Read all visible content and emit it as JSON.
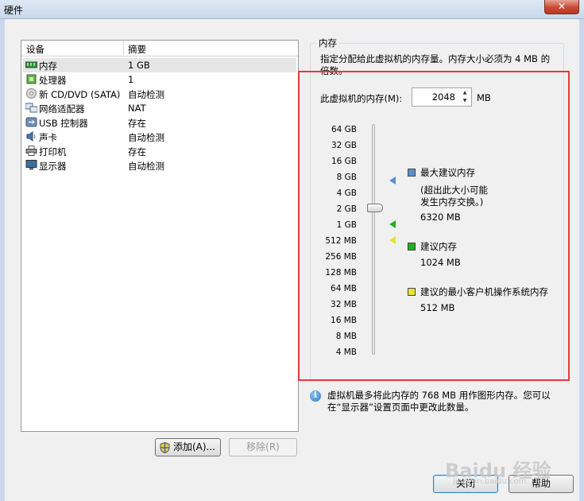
{
  "window": {
    "title": "硬件",
    "close_symbol": "✕"
  },
  "device_list": {
    "headers": {
      "device": "设备",
      "summary": "摘要"
    },
    "rows": [
      {
        "name": "内存",
        "summary": "1 GB",
        "icon": "memory-icon"
      },
      {
        "name": "处理器",
        "summary": "1",
        "icon": "processor-icon"
      },
      {
        "name": "新 CD/DVD (SATA)",
        "summary": "自动检测",
        "icon": "cd-dvd-icon"
      },
      {
        "name": "网络适配器",
        "summary": "NAT",
        "icon": "network-adapter-icon"
      },
      {
        "name": "USB 控制器",
        "summary": "存在",
        "icon": "usb-icon"
      },
      {
        "name": "声卡",
        "summary": "自动检测",
        "icon": "sound-card-icon"
      },
      {
        "name": "打印机",
        "summary": "存在",
        "icon": "printer-icon"
      },
      {
        "name": "显示器",
        "summary": "自动检测",
        "icon": "display-icon"
      }
    ],
    "add_button": "添加(A)...",
    "remove_button": "移除(R)"
  },
  "memory": {
    "group_title": "内存",
    "description": "指定分配给此虚拟机的内存量。内存大小必须为 4 MB 的倍数。",
    "memory_label": "此虚拟机的内存(M):",
    "memory_value": "2048",
    "unit": "MB",
    "slider_ticks": [
      "64 GB",
      "32 GB",
      "16 GB",
      "8 GB",
      "4 GB",
      "2 GB",
      "1 GB",
      "512 MB",
      "256 MB",
      "128 MB",
      "64 MB",
      "32 MB",
      "16 MB",
      "8 MB",
      "4 MB"
    ],
    "slider_value": "2 GB",
    "legend": {
      "max_title": "最大建议内存",
      "max_note_line1": "(超出此大小可能",
      "max_note_line2": "发生内存交换。)",
      "max_value": "6320 MB",
      "rec_title": "建议内存",
      "rec_value": "1024 MB",
      "min_title": "建议的最小客户机操作系统内存",
      "min_value": "512 MB"
    },
    "colors": {
      "max": "#5b8fcf",
      "recommended": "#22b022",
      "minimum": "#e8e23a"
    },
    "info_text": "虚拟机最多将此内存的 768 MB 用作图形内存。您可以在“显示器”设置页面中更改此数量。"
  },
  "footer": {
    "close_button": "关闭",
    "help_button": "帮助"
  },
  "watermark": {
    "brand": "Baidu 经验",
    "url": "jingyan.baidu.com"
  }
}
